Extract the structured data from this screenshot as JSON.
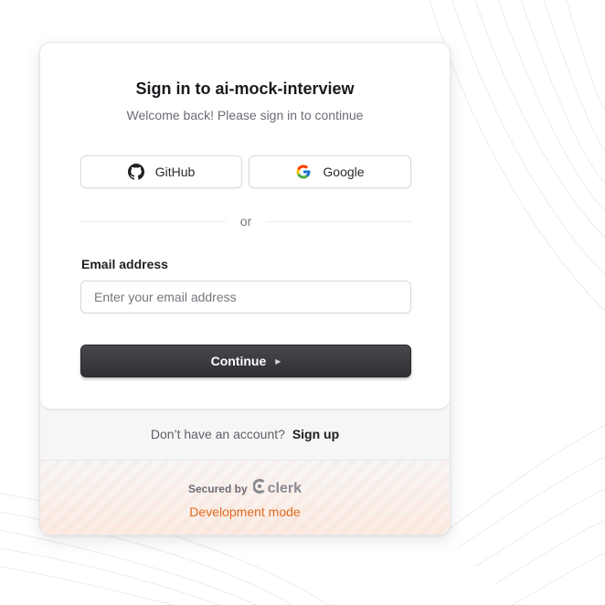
{
  "signin": {
    "title": "Sign in to ai-mock-interview",
    "subtitle": "Welcome back! Please sign in to continue",
    "social": {
      "github_label": "GitHub",
      "google_label": "Google"
    },
    "divider_text": "or",
    "email": {
      "label": "Email address",
      "placeholder": "Enter your email address",
      "value": ""
    },
    "continue_label": "Continue"
  },
  "footer": {
    "signup_prompt": "Don’t have an account?",
    "signup_link": "Sign up",
    "secured_by": "Secured by",
    "brand": "clerk",
    "dev_mode": "Development mode"
  },
  "colors": {
    "primary_button": "#2f2f34",
    "dev_mode_text": "#e2691e",
    "background": "#ffffff"
  }
}
